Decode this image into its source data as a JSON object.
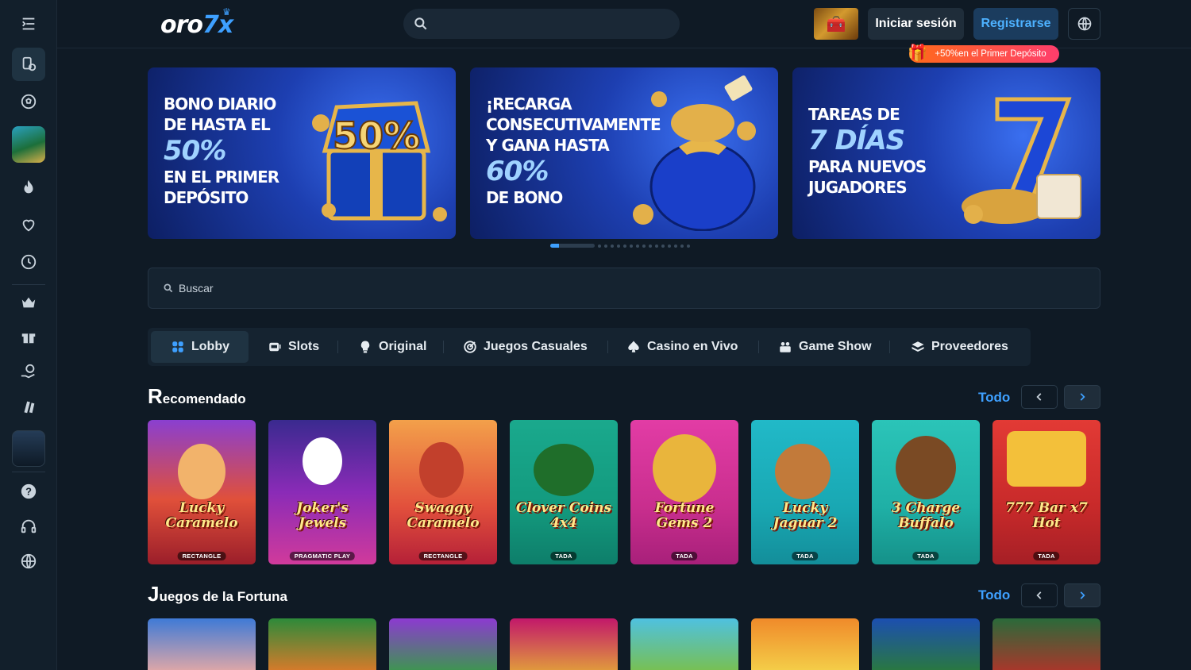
{
  "header": {
    "logo_text": "oro",
    "logo_accent": "7x",
    "login_label": "Iniciar sesión",
    "register_label": "Registrarse",
    "promo_pill": "+50%en el Primer Depósito"
  },
  "rail": {
    "icons": [
      "menu-icon",
      "casino-icon",
      "soccer-ball-icon",
      "promo-thumbnail",
      "fire-icon",
      "heart-icon",
      "clock-icon",
      "crown-icon",
      "gift-icon",
      "money-hand-icon",
      "vip-cards-icon",
      "app-thumbnail",
      "help-icon",
      "headset-icon",
      "globe-icon"
    ]
  },
  "banners": [
    {
      "lines": [
        "BONO DIARIO",
        "DE HASTA EL"
      ],
      "big": "50%",
      "tail": [
        "EN EL PRIMER",
        "DEPÓSITO"
      ],
      "art_text": "50%"
    },
    {
      "lines": [
        "¡RECARGA",
        "CONSECUTIVAMENTE",
        "Y GANA HASTA"
      ],
      "big": "60%",
      "tail": [
        "DE BONO"
      ]
    },
    {
      "lines": [
        "TAREAS DE"
      ],
      "big": "7 DÍAS",
      "tail": [
        "PARA NUEVOS",
        "JUGADORES"
      ]
    }
  ],
  "carousel": {
    "total_dots": 16,
    "active_index": 0
  },
  "search": {
    "placeholder": "Buscar"
  },
  "tabs": [
    {
      "label": "Lobby",
      "icon": "grid-icon",
      "active": true
    },
    {
      "label": "Slots",
      "icon": "slot-machine-icon",
      "active": false
    },
    {
      "label": "Original",
      "icon": "bulb-icon",
      "active": false
    },
    {
      "label": "Juegos Casuales",
      "icon": "target-icon",
      "active": false
    },
    {
      "label": "Casino en Vivo",
      "icon": "spade-icon",
      "active": false
    },
    {
      "label": "Game Show",
      "icon": "show-icon",
      "active": false
    },
    {
      "label": "Proveedores",
      "icon": "layers-icon",
      "active": false
    }
  ],
  "sections": [
    {
      "title": "Recomendado",
      "view_all": "Todo",
      "games": [
        {
          "name": "Lucky Caramelo",
          "provider": "RECTANGLE"
        },
        {
          "name": "Joker's Jewels",
          "provider": "PRAGMATIC PLAY"
        },
        {
          "name": "Swaggy Caramelo",
          "provider": "RECTANGLE"
        },
        {
          "name": "Clover Coins 4x4",
          "provider": "TADA"
        },
        {
          "name": "Fortune Gems 2",
          "provider": "TADA"
        },
        {
          "name": "Lucky Jaguar 2",
          "provider": "TADA"
        },
        {
          "name": "3 Charge Buffalo",
          "provider": "TADA"
        },
        {
          "name": "777 Bar x7 Hot",
          "provider": "TADA"
        }
      ]
    },
    {
      "title": "Juegos de la Fortuna",
      "view_all": "Todo"
    }
  ],
  "colors": {
    "accent": "#3ea0ff",
    "bg": "#0f1a25",
    "panel": "#152330",
    "promo": "#ff6a1a"
  }
}
